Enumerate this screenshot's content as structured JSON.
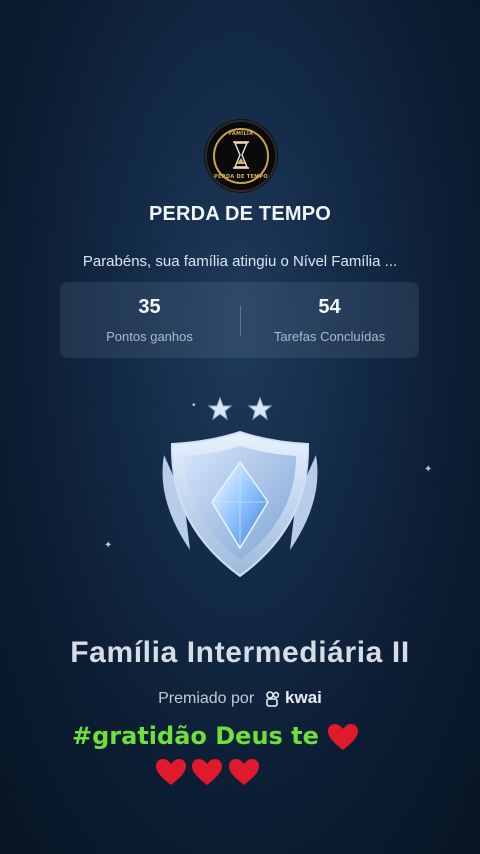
{
  "group": {
    "logo_top_text": "FAMÍLIA",
    "logo_bottom_text": "PERDA DE TEMPO",
    "name": "PERDA DE TEMPO",
    "message": "Parabéns, sua família atingiu o Nível Família ..."
  },
  "stats": [
    {
      "value": "35",
      "label": "Pontos ganhos"
    },
    {
      "value": "54",
      "label": "Tarefas Concluídas"
    }
  ],
  "badge": {
    "icon": "shield-diamond-icon",
    "stars": 2,
    "level_name": "Família Intermediária II"
  },
  "award": {
    "prefix": "Premiado por",
    "brand": "kwai"
  },
  "caption": {
    "text": "#gratidão Deus te",
    "heart_color": "#e0192b"
  },
  "colors": {
    "caption_green": "#6ee03a",
    "background": "#132a45"
  }
}
